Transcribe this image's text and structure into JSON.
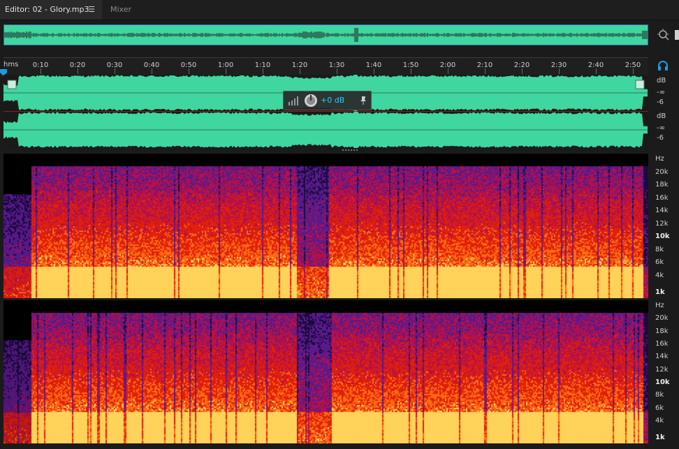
{
  "tabs": {
    "editor_label": "Editor: 02 - Glory.mp3",
    "editor_menu": "☰",
    "mixer_label": "Mixer"
  },
  "ruler": {
    "unit_label": "hms",
    "ticks": [
      "0:10",
      "0:20",
      "0:30",
      "0:40",
      "0:50",
      "1:00",
      "1:10",
      "1:20",
      "1:30",
      "1:40",
      "1:50",
      "2:00",
      "2:10",
      "2:20",
      "2:30",
      "2:40",
      "2:50"
    ]
  },
  "hud": {
    "gain_value": "+0 dB"
  },
  "amplitude_scale": {
    "top": [
      "dB",
      "-∞",
      "-6"
    ],
    "bottom": [
      "dB",
      "-∞",
      "-6"
    ]
  },
  "frequency_scale": {
    "channel1": [
      "Hz",
      "20k",
      "18k",
      "16k",
      "14k",
      "12k",
      "10k",
      "8k",
      "6k",
      "4k",
      "1k"
    ],
    "channel2": [
      "Hz",
      "20k",
      "18k",
      "16k",
      "14k",
      "12k",
      "10k",
      "8k",
      "6k",
      "4k",
      "1k"
    ]
  },
  "colors": {
    "waveform": "#3fd6a0",
    "selection_border": "#3a66b0",
    "hud_value": "#3cc0ff",
    "accent": "#1f9be0"
  },
  "icons": {
    "menu": "hamburger-menu-icon",
    "zoom": "zoom-icon",
    "playhead": "playhead-icon",
    "monitor": "headphones-icon",
    "gain_knob": "knob-icon",
    "pin": "pin-icon"
  }
}
